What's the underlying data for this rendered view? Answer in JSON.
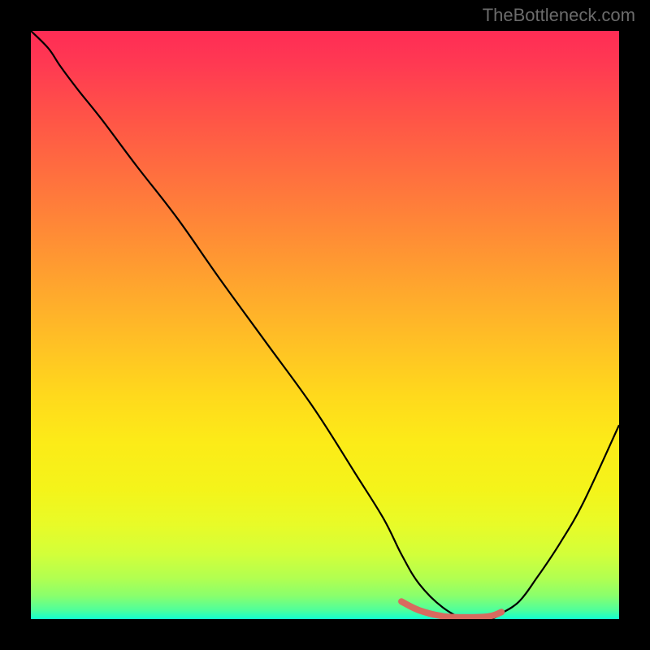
{
  "watermark": "TheBottleneck.com",
  "chart_data": {
    "type": "line",
    "title": "",
    "xlabel": "",
    "ylabel": "",
    "xlim": [
      0,
      100
    ],
    "ylim": [
      0,
      100
    ],
    "series": [
      {
        "name": "curve",
        "x": [
          0,
          3,
          5,
          8,
          12,
          18,
          25,
          32,
          40,
          48,
          55,
          60,
          63,
          66,
          70,
          74,
          78,
          80,
          83,
          86,
          90,
          94,
          100
        ],
        "y": [
          100,
          97,
          94,
          90,
          85,
          77,
          68,
          58,
          47,
          36,
          25,
          17,
          11,
          6,
          2,
          0,
          0,
          1,
          3,
          7,
          13,
          20,
          33
        ]
      },
      {
        "name": "highlight-region",
        "x": [
          63,
          66,
          70,
          74,
          78,
          80
        ],
        "y": [
          3.0,
          1.5,
          0.5,
          0.3,
          0.5,
          1.2
        ]
      }
    ],
    "background_gradient": {
      "top": "#ff2c55",
      "mid": "#ffd91c",
      "bottom": "#12ffd0"
    },
    "annotations": []
  }
}
